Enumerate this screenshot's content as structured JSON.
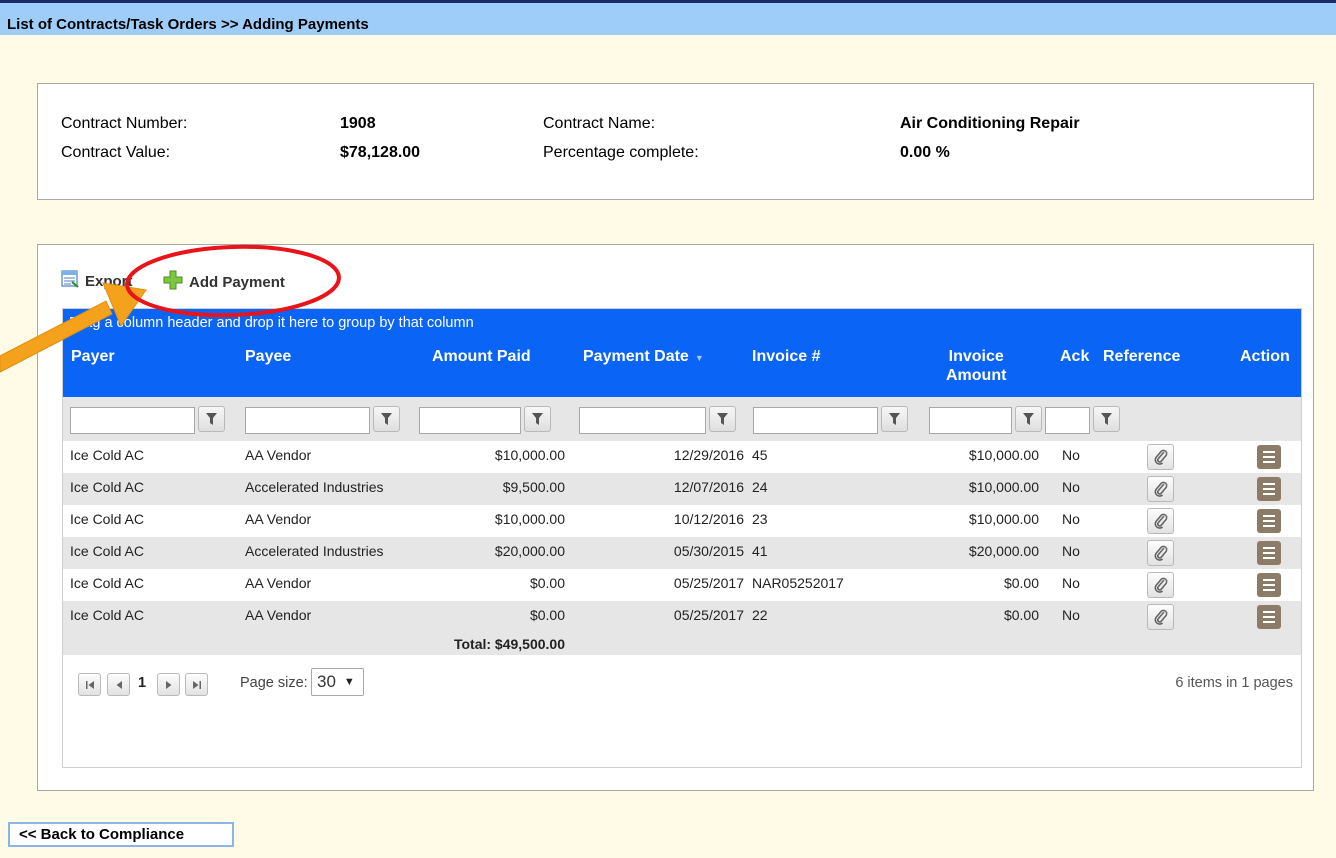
{
  "title": "List of Contracts/Task Orders >> Adding Payments",
  "contract": {
    "number_label": "Contract Number:",
    "number_value": "1908",
    "name_label": "Contract Name:",
    "name_value": "Air Conditioning Repair",
    "value_label": "Contract Value:",
    "value_value": "$78,128.00",
    "percent_label": "Percentage complete:",
    "percent_value": "0.00 %"
  },
  "toolbar": {
    "export_label": "Export",
    "add_payment_label": "Add Payment"
  },
  "grid": {
    "group_hint": "Drag a column header and drop it here to group by that column",
    "columns": {
      "payer": "Payer",
      "payee": "Payee",
      "amount_paid": "Amount Paid",
      "payment_date": "Payment Date",
      "invoice_no": "Invoice #",
      "invoice_amount_1": "Invoice",
      "invoice_amount_2": "Amount",
      "ack": "Ack",
      "reference": "Reference",
      "action": "Action"
    },
    "rows": [
      {
        "payer": "Ice Cold AC",
        "payee": "AA Vendor",
        "amount_paid": "$10,000.00",
        "payment_date": "12/29/2016",
        "invoice_no": "45",
        "invoice_amount": "$10,000.00",
        "ack": "No"
      },
      {
        "payer": "Ice Cold AC",
        "payee": "Accelerated Industries",
        "amount_paid": "$9,500.00",
        "payment_date": "12/07/2016",
        "invoice_no": "24",
        "invoice_amount": "$10,000.00",
        "ack": "No"
      },
      {
        "payer": "Ice Cold AC",
        "payee": "AA Vendor",
        "amount_paid": "$10,000.00",
        "payment_date": "10/12/2016",
        "invoice_no": "23",
        "invoice_amount": "$10,000.00",
        "ack": "No"
      },
      {
        "payer": "Ice Cold AC",
        "payee": "Accelerated Industries",
        "amount_paid": "$20,000.00",
        "payment_date": "05/30/2015",
        "invoice_no": "41",
        "invoice_amount": "$20,000.00",
        "ack": "No"
      },
      {
        "payer": "Ice Cold AC",
        "payee": "AA Vendor",
        "amount_paid": "$0.00",
        "payment_date": "05/25/2017",
        "invoice_no": "NAR05252017",
        "invoice_amount": "$0.00",
        "ack": "No"
      },
      {
        "payer": "Ice Cold AC",
        "payee": "AA Vendor",
        "amount_paid": "$0.00",
        "payment_date": "05/25/2017",
        "invoice_no": "22",
        "invoice_amount": "$0.00",
        "ack": "No"
      }
    ],
    "total": "Total: $49,500.00"
  },
  "pager": {
    "current_page": "1",
    "page_size_label": "Page size:",
    "page_size_value": "30",
    "summary": "6 items in 1 pages"
  },
  "back_button": "<< Back to Compliance",
  "colors": {
    "grid_header": "#0a64f5",
    "title_bar": "#9ecdfa",
    "page_background": "#fffbe6",
    "highlight_circle": "#e8141a",
    "arrow": "#f4a21c",
    "action_button": "#8c7b66"
  }
}
